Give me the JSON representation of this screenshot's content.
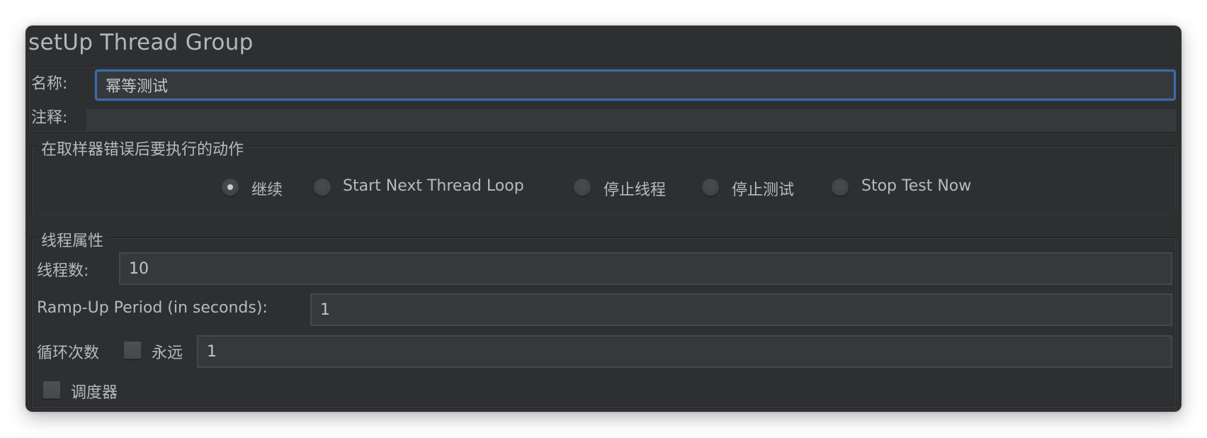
{
  "window": {
    "title": "setUp Thread Group"
  },
  "name_panel": {
    "name_label": "名称:",
    "name_value": "幂等测试",
    "comment_label": "注释:",
    "comment_value": ""
  },
  "error_action": {
    "legend": "在取样器错误后要执行的动作",
    "options": [
      {
        "label": "继续",
        "checked": true
      },
      {
        "label": "Start Next Thread Loop",
        "checked": false
      },
      {
        "label": "停止线程",
        "checked": false
      },
      {
        "label": "停止测试",
        "checked": false
      },
      {
        "label": "Stop Test Now",
        "checked": false
      }
    ]
  },
  "thread_properties": {
    "legend": "线程属性",
    "thread_count_label": "线程数:",
    "thread_count_value": "10",
    "ramp_up_label": "Ramp-Up Period (in seconds):",
    "ramp_up_value": "1",
    "loop_count_label": "循环次数",
    "forever_label": "永远",
    "forever_checked": false,
    "loop_count_value": "1",
    "scheduler_label": "调度器",
    "scheduler_checked": false
  },
  "colors": {
    "window_bg": "#2e2f31",
    "field_bg": "#36393b",
    "focus_border": "#3d6ba8",
    "text": "#b7babd"
  }
}
